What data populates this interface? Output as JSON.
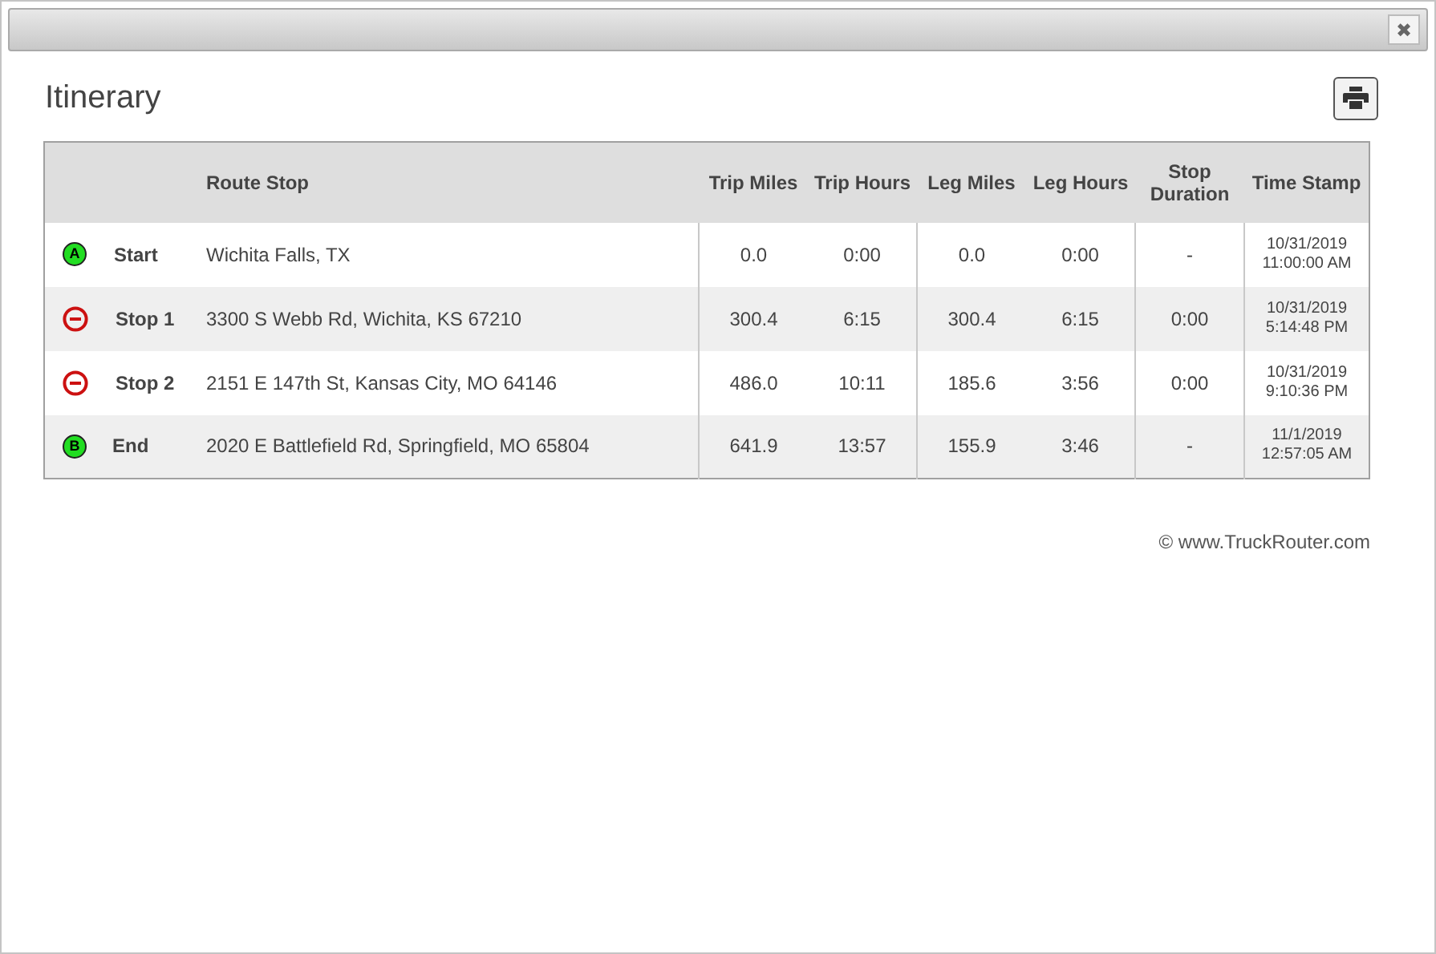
{
  "dialog": {
    "close_button": "✖"
  },
  "title": "Itinerary",
  "table": {
    "columns": [
      "Route Stop",
      "Trip Miles",
      "Trip Hours",
      "Leg Miles",
      "Leg Hours",
      "Stop Duration",
      "Time Stamp"
    ],
    "rows": [
      {
        "kind": "start",
        "marker": "A",
        "label": "Start",
        "route_stop": "Wichita Falls, TX",
        "trip_miles": "0.0",
        "trip_hours": "0:00",
        "leg_miles": "0.0",
        "leg_hours": "0:00",
        "stop_duration": "-",
        "time_stamp": [
          "10/31/2019",
          "11:00:00 AM"
        ]
      },
      {
        "kind": "stop",
        "label": "Stop 1",
        "route_stop": "3300 S Webb Rd, Wichita, KS 67210",
        "trip_miles": "300.4",
        "trip_hours": "6:15",
        "leg_miles": "300.4",
        "leg_hours": "6:15",
        "stop_duration": "0:00",
        "time_stamp": [
          "10/31/2019",
          "5:14:48 PM"
        ]
      },
      {
        "kind": "stop",
        "label": "Stop 2",
        "route_stop": "2151 E 147th St, Kansas City, MO 64146",
        "trip_miles": "486.0",
        "trip_hours": "10:11",
        "leg_miles": "185.6",
        "leg_hours": "3:56",
        "stop_duration": "0:00",
        "time_stamp": [
          "10/31/2019",
          "9:10:36 PM"
        ]
      },
      {
        "kind": "end",
        "marker": "B",
        "label": "End",
        "route_stop": "2020 E Battlefield Rd, Springfield, MO 65804",
        "trip_miles": "641.9",
        "trip_hours": "13:57",
        "leg_miles": "155.9",
        "leg_hours": "3:46",
        "stop_duration": "-",
        "time_stamp": [
          "11/1/2019",
          "12:57:05 AM"
        ]
      }
    ]
  },
  "footer": "© www.TruckRouter.com"
}
